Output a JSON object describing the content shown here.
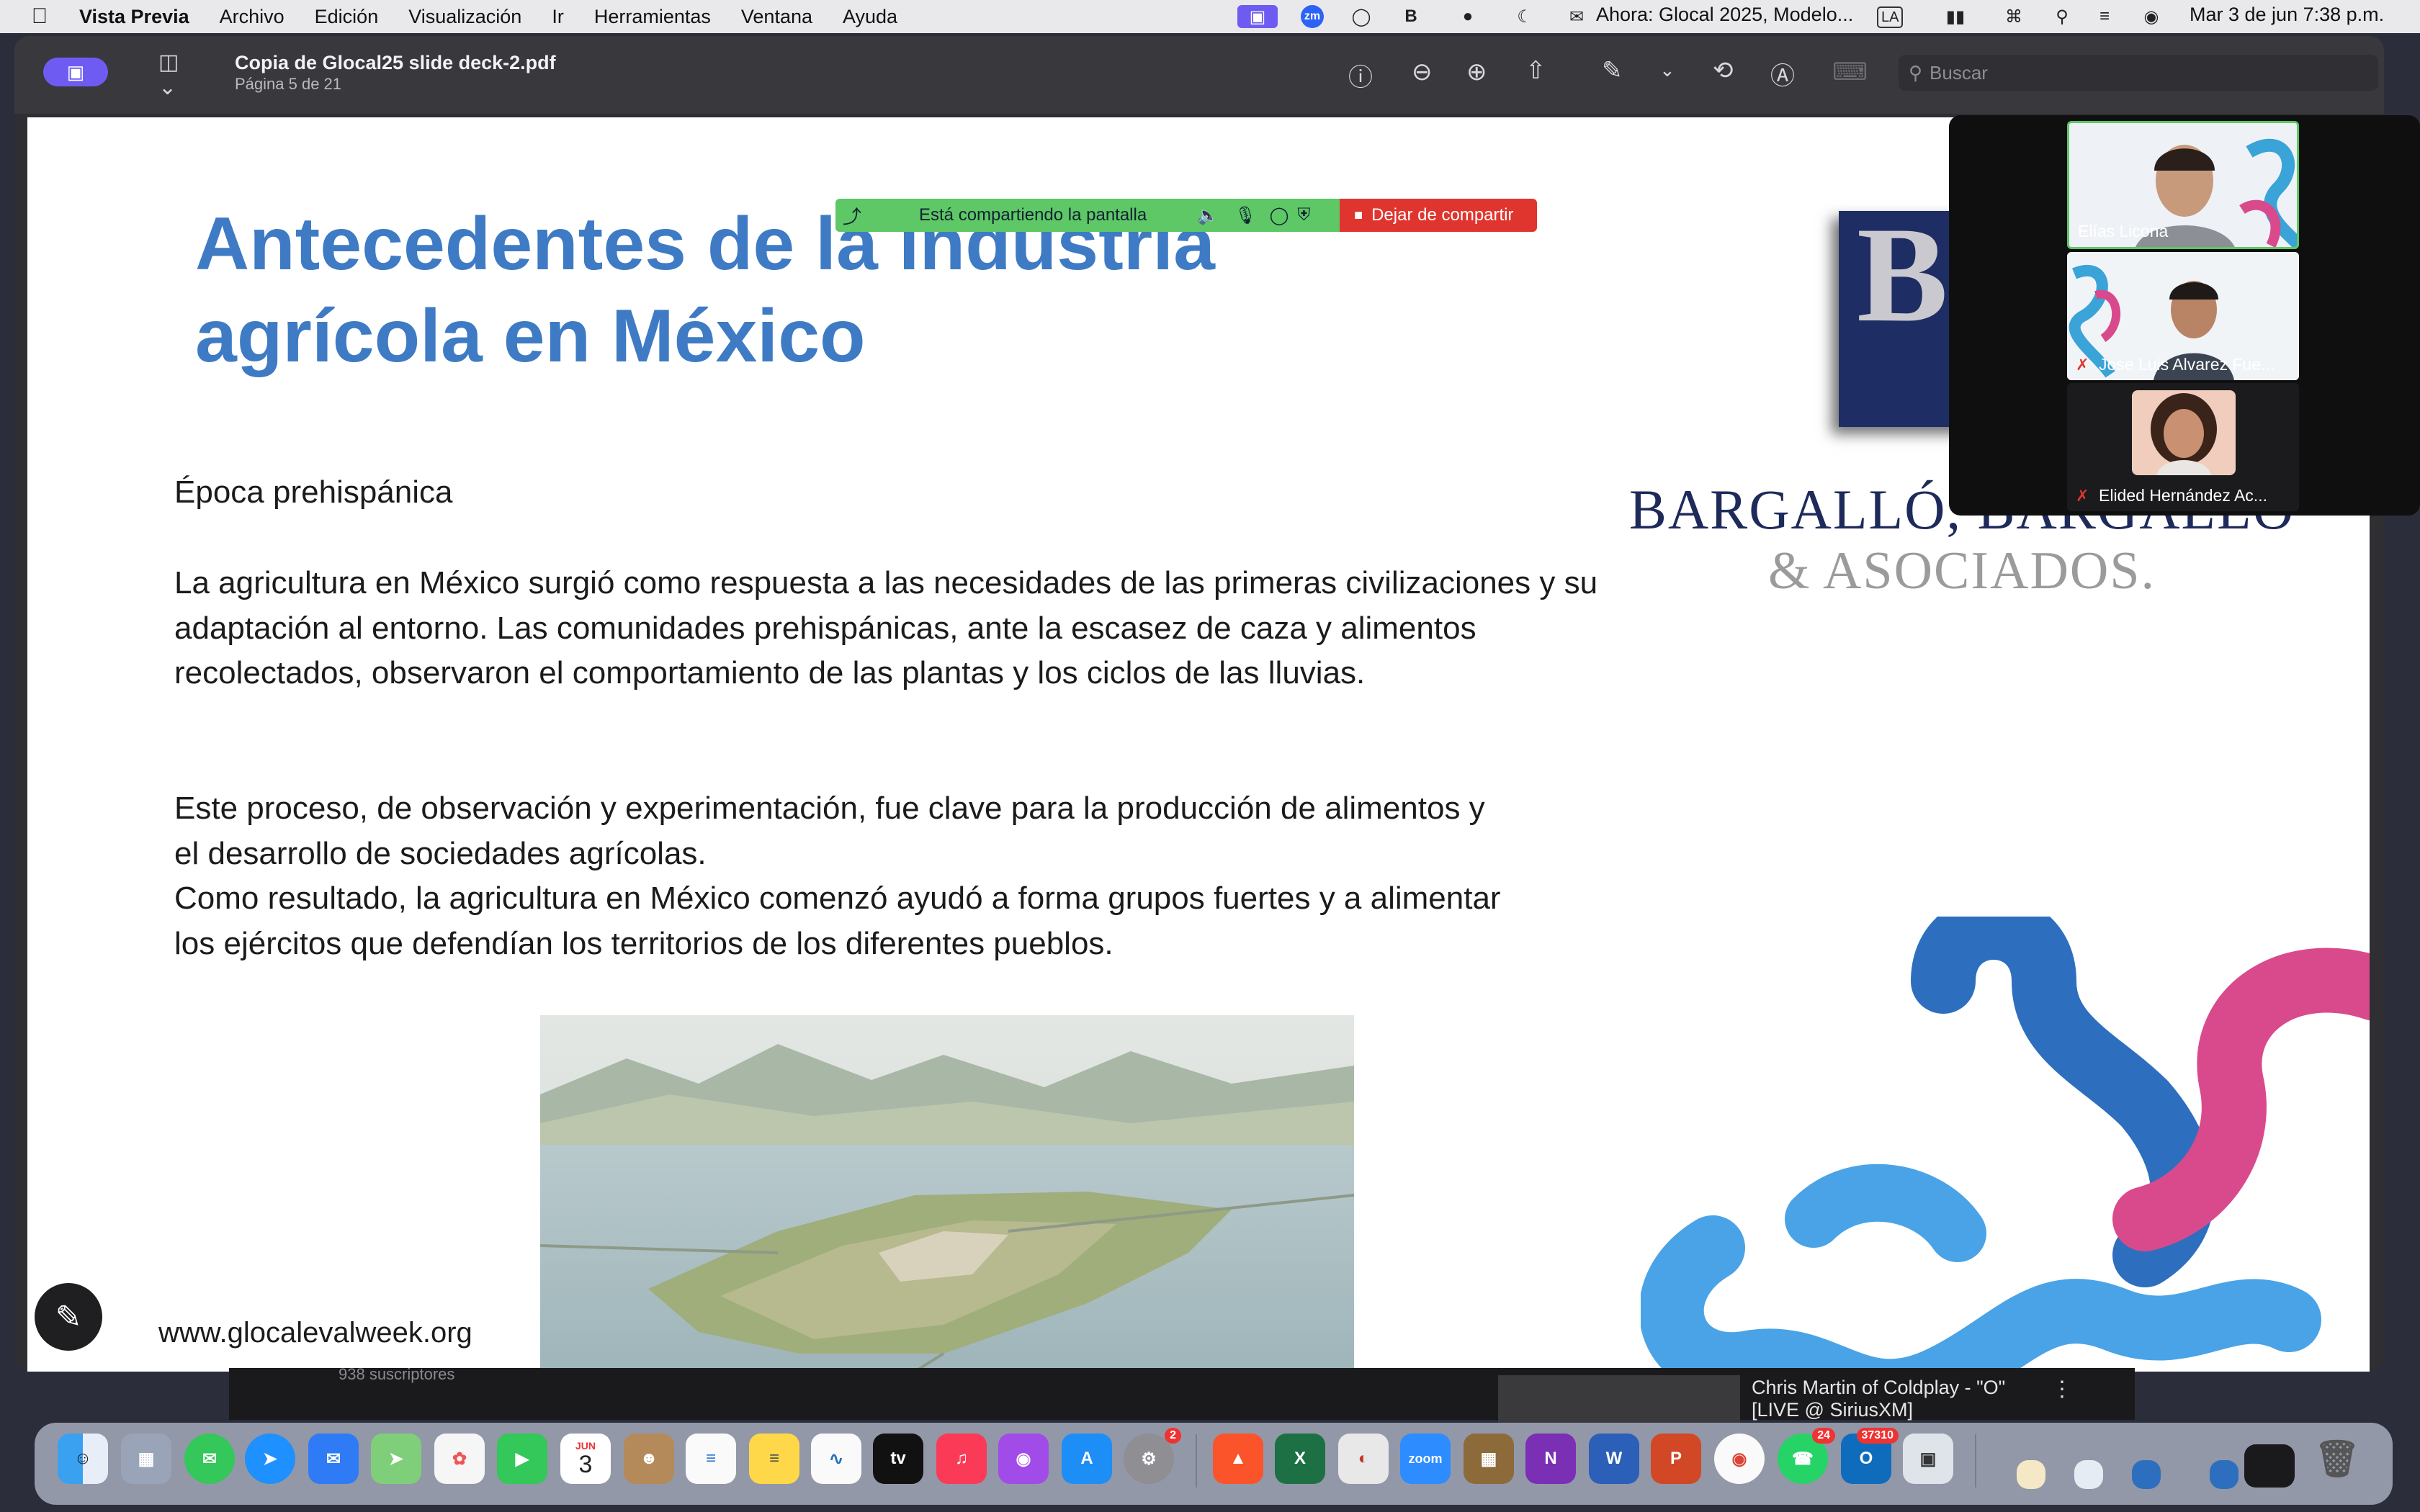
{
  "menubar": {
    "app_name": "Vista Previa",
    "menus": [
      "Archivo",
      "Edición",
      "Visualización",
      "Ir",
      "Herramientas",
      "Ventana",
      "Ayuda"
    ],
    "now_playing": "Ahora: Glocal 2025, Modelo...",
    "input_source": "LA",
    "zoom_badge": "zm",
    "datetime": "Mar 3 de jun  7:38 p.m."
  },
  "preview": {
    "file_name": "Copia de Glocal25 slide deck-2.pdf",
    "page_info": "Página 5 de 21",
    "search_placeholder": "Buscar"
  },
  "slide": {
    "title_line1": "Antecedentes de la industria",
    "title_line2": "agrícola en México",
    "section_heading": "Época prehispánica",
    "paragraph_1": "La agricultura en México surgió como respuesta a las necesidades de las primeras civilizaciones y su adaptación al entorno. Las comunidades prehispánicas, ante la escasez de caza y alimentos recolectados, observaron el comportamiento de las plantas y los ciclos de las lluvias.",
    "paragraph_2": "Este proceso, de observación y experimentación, fue clave para la producción de alimentos y el desarrollo de sociedades agrícolas.",
    "paragraph_3": "Como resultado, la agricultura en México comenzó ayudó a forma grupos fuertes y a alimentar los ejércitos que defendían los territorios de los diferentes pueblos.",
    "website": "www.glocalevalweek.org",
    "logo_letter": "B",
    "brand_name": "BARGALLÓ, BARGALLÓ",
    "brand_sub": "& ASOCIADOS."
  },
  "share_bar": {
    "status": "Está compartiendo la pantalla",
    "stop_label": "Dejar de compartir"
  },
  "participants": [
    {
      "name": "Elías Licona",
      "muted": false
    },
    {
      "name": "Jose Luis Alvarez Fue...",
      "muted": true
    },
    {
      "name": "Elided Hernández Ac...",
      "muted": true
    }
  ],
  "background_window": {
    "song_line1": "Chris Martin of Coldplay - \"O\"",
    "song_line2": "[LIVE @ SiriusXM]",
    "subscribers": "938 suscriptores"
  },
  "dock": {
    "calendar_month": "JUN",
    "calendar_day": "3",
    "appletv_label": "tv",
    "zoom_label": "zoom",
    "settings_badge": "2",
    "whatsapp_badge": "24",
    "outlook_badge": "37310"
  },
  "colors": {
    "title_blue": "#3e7bc4",
    "share_green": "#5ec766",
    "stop_red": "#e0352f",
    "accent_purple": "#6e5cf2",
    "brand_navy": "#1d2a5a",
    "deco_blue": "#4aa3e6",
    "deco_darkblue": "#2d6fbe",
    "deco_pink": "#d94a8c"
  }
}
